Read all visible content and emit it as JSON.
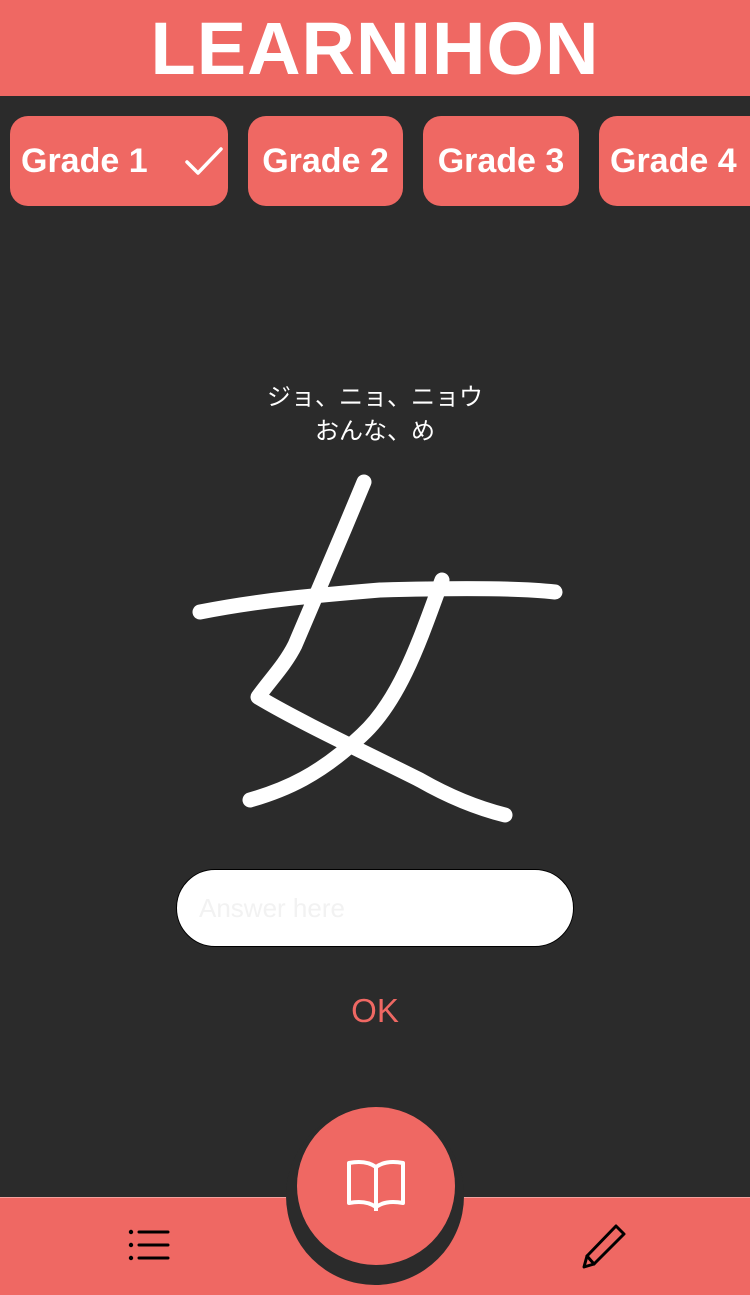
{
  "app": {
    "title": "LEARNIHON"
  },
  "grades": [
    {
      "label": "Grade 1",
      "selected": true
    },
    {
      "label": "Grade 2",
      "selected": false
    },
    {
      "label": "Grade 3",
      "selected": false
    },
    {
      "label": "Grade 4",
      "selected": false
    }
  ],
  "card": {
    "on_reading": "ジョ、ニョ、ニョウ",
    "kun_reading": "おんな、め",
    "kanji": "女"
  },
  "answer": {
    "placeholder": "Answer here",
    "value": ""
  },
  "actions": {
    "ok_label": "OK"
  },
  "nav": {
    "left_icon": "list-icon",
    "center_icon": "book-open-icon",
    "right_icon": "pencil-icon"
  },
  "colors": {
    "accent": "#ef6863",
    "background": "#2b2b2b",
    "text": "#ffffff"
  }
}
